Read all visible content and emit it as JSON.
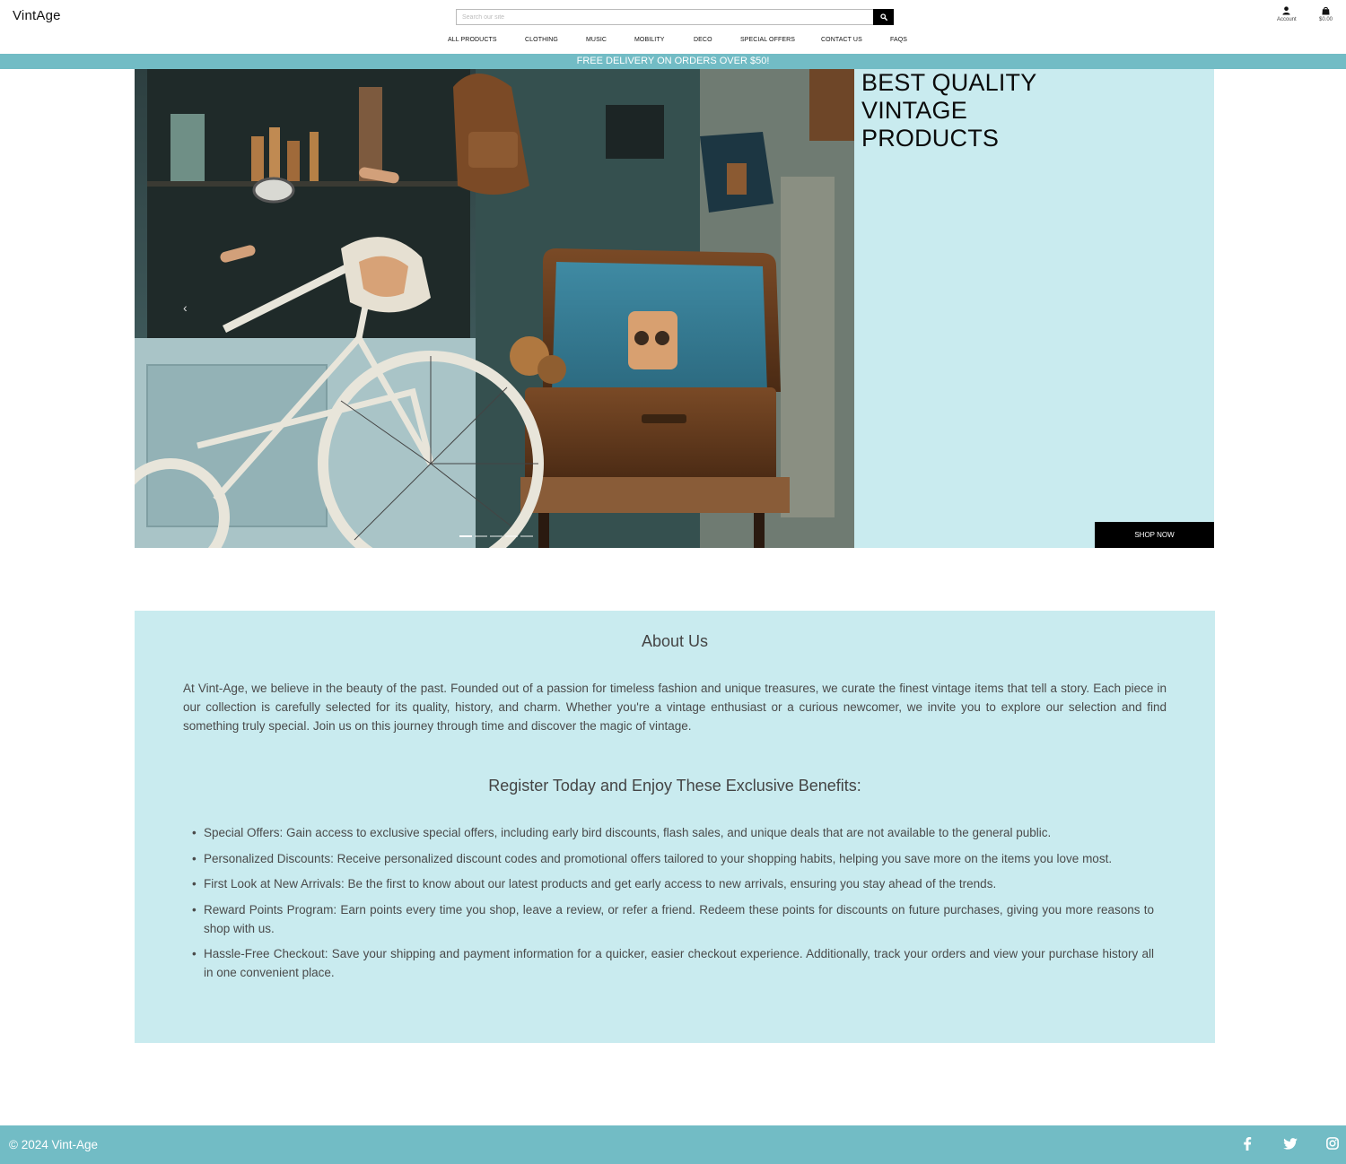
{
  "header": {
    "logo": "VintAge",
    "search_placeholder": "Search our site",
    "account_label": "Account",
    "cart_total": "$0.00"
  },
  "nav": {
    "items": [
      "ALL PRODUCTS",
      "CLOTHING",
      "MUSIC",
      "MOBILITY",
      "DECO",
      "SPECIAL OFFERS",
      "CONTACT US",
      "FAQS"
    ]
  },
  "banner": {
    "text": "FREE DELIVERY ON ORDERS OVER $50!"
  },
  "hero": {
    "title": "BEST QUALITY\nVINTAGE\nPRODUCTS",
    "cta": "SHOP NOW",
    "slides_count": 5,
    "active_slide": 1
  },
  "about": {
    "heading": "About Us",
    "intro": "At Vint-Age, we believe in the beauty of the past. Founded out of a passion for timeless fashion and unique treasures, we curate the finest vintage items that tell a story. Each piece in our collection is carefully selected for its quality, history, and charm. Whether you're a vintage enthusiast or a curious newcomer, we invite you to explore our selection and find something truly special. Join us on this journey through time and discover the magic of vintage.",
    "benefits_heading": "Register Today and Enjoy These Exclusive Benefits:",
    "benefits": [
      "Special Offers: Gain access to exclusive special offers, including early bird discounts, flash sales, and unique deals that are not available to the general public.",
      "Personalized Discounts: Receive personalized discount codes and promotional offers tailored to your shopping habits, helping you save more on the items you love most.",
      "First Look at New Arrivals: Be the first to know about our latest products and get early access to new arrivals, ensuring you stay ahead of the trends.",
      "Reward Points Program: Earn points every time you shop, leave a review, or refer a friend. Redeem these points for discounts on future purchases, giving you more reasons to shop with us.",
      "Hassle-Free Checkout: Save your shipping and payment information for a quicker, easier checkout experience. Additionally, track your orders and view your purchase history all in one convenient place."
    ]
  },
  "footer": {
    "copyright": "© 2024 Vint-Age",
    "social": [
      "facebook-icon",
      "twitter-icon",
      "instagram-icon"
    ]
  },
  "colors": {
    "accent": "#72bcc5",
    "panel": "#c9ebef",
    "button": "#000000"
  }
}
